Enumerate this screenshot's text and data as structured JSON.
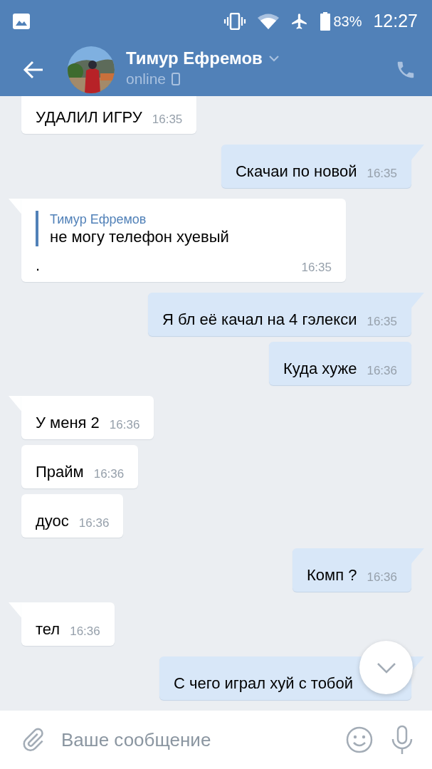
{
  "status_bar": {
    "battery": "83%",
    "time": "12:27"
  },
  "header": {
    "name": "Тимур Ефремов",
    "status": "online"
  },
  "messages": [
    {
      "kind": "incoming",
      "text": "УДАЛИЛ ИГРУ",
      "time": "16:35"
    },
    {
      "kind": "outgoing",
      "text": "Скачаи по новой",
      "time": "16:35"
    },
    {
      "kind": "incoming",
      "reply": {
        "author": "Тимур Ефремов",
        "text": "не могу телефон хуевый"
      },
      "text": ".",
      "time": "16:35"
    },
    {
      "kind": "outgoing",
      "text": "Я бл её качал на 4 гэлекси",
      "time": "16:35"
    },
    {
      "kind": "outgoing",
      "text": "Куда хуже",
      "time": "16:36"
    },
    {
      "kind": "incoming",
      "text": "У меня 2",
      "time": "16:36"
    },
    {
      "kind": "incoming",
      "text": "Прайм",
      "time": "16:36"
    },
    {
      "kind": "incoming",
      "text": "дуос",
      "time": "16:36"
    },
    {
      "kind": "outgoing",
      "text": "Комп ?",
      "time": "16:36"
    },
    {
      "kind": "incoming",
      "text": "тел",
      "time": "16:36"
    },
    {
      "kind": "outgoing",
      "text": "С чего играл хуй с тобой"
    }
  ],
  "input": {
    "placeholder": "Ваше сообщение"
  }
}
